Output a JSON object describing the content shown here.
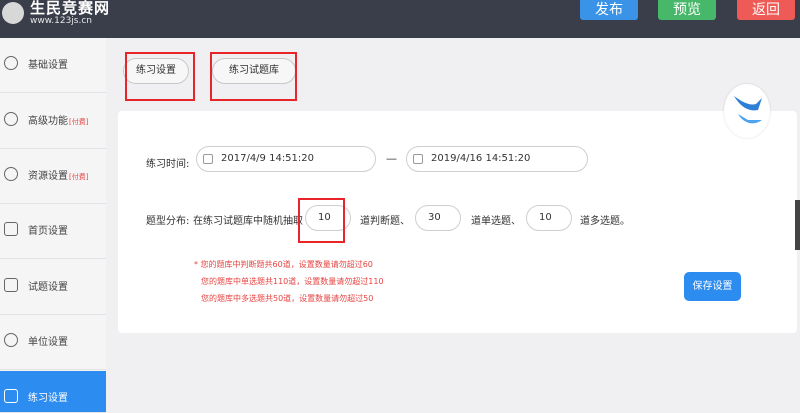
{
  "header": {
    "logo_title": "生民竞赛网",
    "logo_url": "www.123js.cn",
    "publish_label": "发布",
    "preview_label": "预览",
    "back_label": "返回"
  },
  "sidebar": {
    "items": [
      {
        "label": "基础设置",
        "tag": "",
        "icon": "gear-icon"
      },
      {
        "label": "高级功能",
        "tag": "[付费]",
        "icon": "gear-icon"
      },
      {
        "label": "资源设置",
        "tag": "[付费]",
        "icon": "gear-icon"
      },
      {
        "label": "首页设置",
        "tag": "",
        "icon": "page-icon"
      },
      {
        "label": "试题设置",
        "tag": "",
        "icon": "edit-icon"
      },
      {
        "label": "单位设置",
        "tag": "",
        "icon": "user-icon"
      },
      {
        "label": "练习设置",
        "tag": "",
        "icon": "book-icon"
      }
    ]
  },
  "tabs": [
    "练习设置",
    "练习试题库"
  ],
  "form": {
    "time_label": "练习时间:",
    "start_date": "2017/4/9 14:51:20",
    "end_date": "2019/4/16 14:51:20",
    "dash": "—",
    "dist_label": "题型分布:",
    "dist_prefix": "在练习试题库中随机抽取",
    "judge_count": "10",
    "judge_suffix": "道判断题、",
    "single_count": "30",
    "single_suffix": "道单选题、",
    "multi_count": "10",
    "multi_suffix": "道多选题。",
    "warnings": [
      "* 您的题库中判断题共60道，设置数量请勿超过60",
      "您的题库中单选题共110道，设置数量请勿超过110",
      "您的题库中多选题共50道，设置数量请勿超过50"
    ],
    "save_label": "保存设置"
  },
  "colors": {
    "header_bg": "#3a3d4a",
    "publish": "#3b93e8",
    "preview": "#47b86a",
    "back": "#ee5a55",
    "active_blue": "#2d8cf0",
    "warning_red": "#e64340",
    "highlight_red": "#e8262a"
  }
}
